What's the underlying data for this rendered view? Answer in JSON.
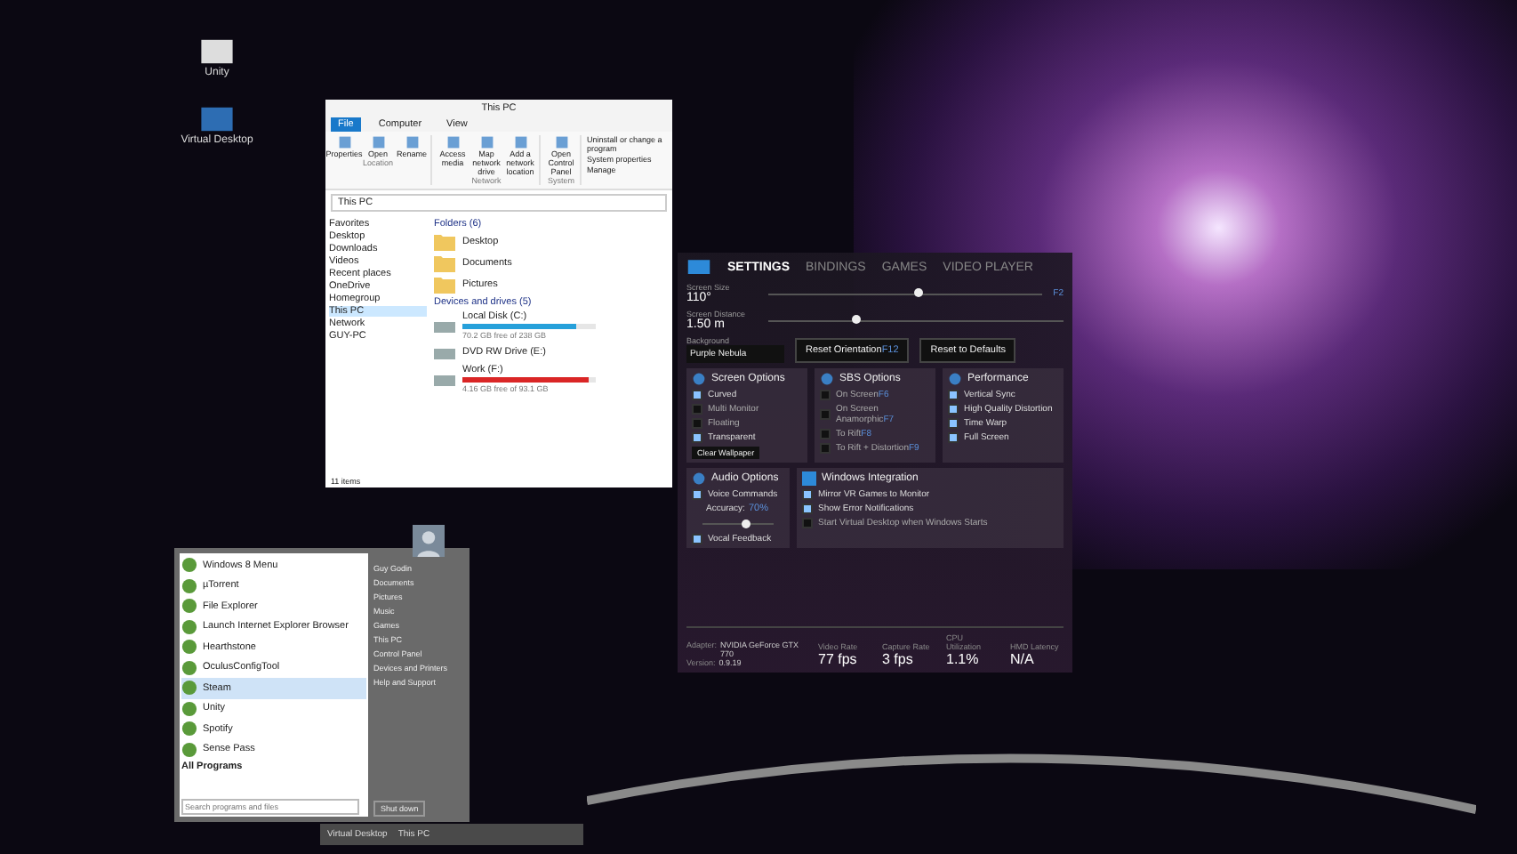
{
  "desktop_icons": [
    {
      "label": "Unity"
    },
    {
      "label": "Virtual Desktop"
    }
  ],
  "explorer": {
    "title": "This PC",
    "ribbon_tabs": [
      {
        "label": "File",
        "selected": true
      },
      {
        "label": "Computer",
        "selected": false
      },
      {
        "label": "View",
        "selected": false
      }
    ],
    "ribbon_groups": [
      {
        "label": "Location",
        "buttons": [
          "Properties",
          "Open",
          "Rename"
        ]
      },
      {
        "label": "Network",
        "buttons": [
          "Access media",
          "Map network drive",
          "Add a network location"
        ]
      },
      {
        "label": "System",
        "buttons": [
          "Open Control Panel"
        ]
      }
    ],
    "system_links": [
      "Uninstall or change a program",
      "System properties",
      "Manage"
    ],
    "address": "This PC",
    "nav": [
      {
        "label": "Favorites",
        "selected": false
      },
      {
        "label": "Desktop",
        "selected": false
      },
      {
        "label": "Downloads",
        "selected": false
      },
      {
        "label": "Videos",
        "selected": false
      },
      {
        "label": "Recent places",
        "selected": false
      },
      {
        "label": "OneDrive",
        "selected": false
      },
      {
        "label": "Homegroup",
        "selected": false
      },
      {
        "label": "This PC",
        "selected": true
      },
      {
        "label": "Network",
        "selected": false
      },
      {
        "label": "GUY-PC",
        "selected": false
      }
    ],
    "folders_header": "Folders (6)",
    "folders": [
      "Desktop",
      "Documents",
      "Pictures"
    ],
    "drives_header": "Devices and drives (5)",
    "drives": [
      {
        "name": "Local Disk (C:)",
        "kind": "disk",
        "level": 0.85,
        "color": "#26a0da",
        "free": "70.2 GB free of 238 GB"
      },
      {
        "name": "DVD RW Drive (E:)",
        "kind": "optical"
      },
      {
        "name": "Work (F:)",
        "kind": "disk",
        "level": 0.95,
        "color": "#da2626",
        "free": "4.16 GB free of 93.1 GB"
      }
    ],
    "status": "11 items"
  },
  "settings": {
    "tabs": [
      {
        "label": "SETTINGS",
        "selected": true
      },
      {
        "label": "BINDINGS",
        "selected": false
      },
      {
        "label": "GAMES",
        "selected": false
      },
      {
        "label": "VIDEO PLAYER",
        "selected": false
      }
    ],
    "sliders": [
      {
        "label": "Screen Size",
        "value": "110°",
        "hotkey": "F2",
        "level": 0.55
      },
      {
        "label": "Screen Distance",
        "value": "1.50 m",
        "level": 0.3
      }
    ],
    "background_label": "Background",
    "background": "Purple Nebula",
    "buttons": [
      {
        "label": "Reset Orientation",
        "hotkey": "F12"
      },
      {
        "label": "Reset to Defaults"
      }
    ],
    "groups": [
      {
        "title": "Screen Options",
        "options": [
          {
            "label": "Curved",
            "checked": true
          },
          {
            "label": "Multi Monitor",
            "checked": false
          },
          {
            "label": "Floating",
            "checked": false
          },
          {
            "label": "Transparent",
            "checked": true
          }
        ],
        "button": "Clear Wallpaper"
      },
      {
        "title": "SBS Options",
        "options": [
          {
            "label": "On Screen",
            "hotkey": "F6",
            "checked": false
          },
          {
            "label": "On Screen Anamorphic",
            "hotkey": "F7",
            "checked": false
          },
          {
            "label": "To Rift",
            "hotkey": "F8",
            "checked": false
          },
          {
            "label": "To Rift + Distortion",
            "hotkey": "F9",
            "checked": false
          }
        ]
      },
      {
        "title": "Performance",
        "options": [
          {
            "label": "Vertical Sync",
            "checked": true
          },
          {
            "label": "High Quality Distortion",
            "checked": true
          },
          {
            "label": "Time Warp",
            "checked": true
          },
          {
            "label": "Full Screen",
            "checked": true
          }
        ]
      }
    ],
    "audio": {
      "title": "Audio Options",
      "voice": {
        "label": "Voice Commands",
        "checked": true
      },
      "accuracy_label": "Accuracy:",
      "accuracy": "70%",
      "level": 0.6,
      "feedback": {
        "label": "Vocal Feedback",
        "checked": true
      }
    },
    "windows": {
      "title": "Windows Integration",
      "options": [
        {
          "label": "Mirror VR Games to Monitor",
          "checked": true
        },
        {
          "label": "Show Error Notifications",
          "checked": true
        },
        {
          "label": "Start Virtual Desktop when Windows Starts",
          "checked": false
        }
      ]
    },
    "info": [
      {
        "label": "Adapter:",
        "value": "NVIDIA GeForce GTX 770"
      },
      {
        "label": "Version:",
        "value": "0.9.19"
      }
    ],
    "stats": [
      {
        "label": "Video Rate",
        "value": "77 fps"
      },
      {
        "label": "Capture Rate",
        "value": "3 fps"
      },
      {
        "label": "CPU Utilization",
        "value": "1.1%"
      },
      {
        "label": "HMD Latency",
        "value": "N/A"
      }
    ]
  },
  "start_menu": {
    "programs": [
      {
        "label": "Windows 8 Menu",
        "selected": false
      },
      {
        "label": "µTorrent",
        "selected": false
      },
      {
        "label": "File Explorer",
        "selected": false
      },
      {
        "label": "Launch Internet Explorer Browser",
        "selected": false
      },
      {
        "label": "Hearthstone",
        "selected": false
      },
      {
        "label": "OculusConfigTool",
        "selected": false
      },
      {
        "label": "Steam",
        "selected": true
      },
      {
        "label": "Unity",
        "selected": false
      },
      {
        "label": "Spotify",
        "selected": false
      },
      {
        "label": "Sense Pass",
        "selected": false
      }
    ],
    "all_programs": "All Programs",
    "search_placeholder": "Search programs and files",
    "places": [
      "Guy Godin",
      "Documents",
      "Pictures",
      "Music",
      "Games",
      "This PC",
      "Control Panel",
      "Devices and Printers",
      "Help and Support"
    ],
    "shutdown": "Shut down"
  },
  "taskbar": [
    {
      "label": "Virtual Desktop"
    },
    {
      "label": "This PC"
    }
  ]
}
